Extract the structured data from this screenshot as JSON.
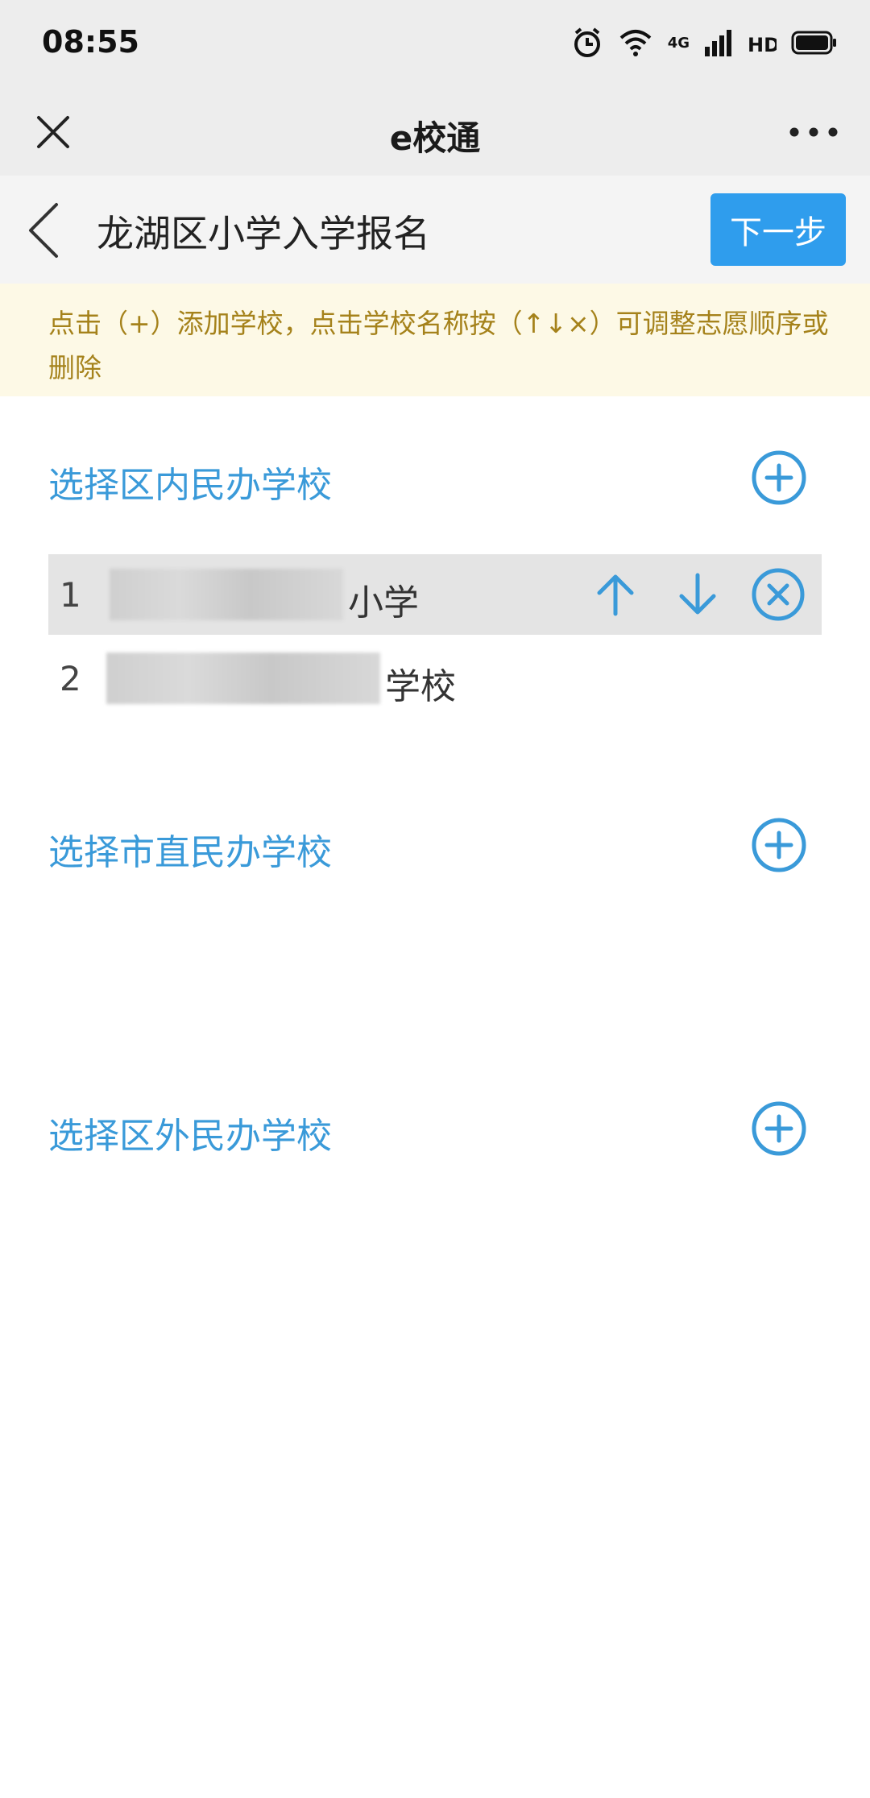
{
  "status_bar": {
    "time": "08:55",
    "network": "4G",
    "icons": [
      "alarm-icon",
      "wifi-icon",
      "signal-icon",
      "hd-icon",
      "battery-icon"
    ]
  },
  "wechat_bar": {
    "title": "e校通",
    "icons": [
      "close-icon",
      "more-icon"
    ]
  },
  "page_header": {
    "title": "龙湖区小学入学报名",
    "next_label": "下一步"
  },
  "notice": {
    "text": "点击（+）添加学校，点击学校名称按（↑↓×）可调整志愿顺序或删除"
  },
  "sections": [
    {
      "title": "选择区内民办学校",
      "schools": [
        {
          "index": "1",
          "name_suffix": "小学",
          "selected": true
        },
        {
          "index": "2",
          "name_suffix": "学校",
          "selected": false
        }
      ]
    },
    {
      "title": "选择市直民办学校",
      "schools": []
    },
    {
      "title": "选择区外民办学校",
      "schools": []
    }
  ],
  "colors": {
    "accent": "#3a9ad9",
    "button": "#2f9ded",
    "notice_bg": "#fdf9e6",
    "notice_text": "#a5821b",
    "bar_bg": "#ededed"
  }
}
